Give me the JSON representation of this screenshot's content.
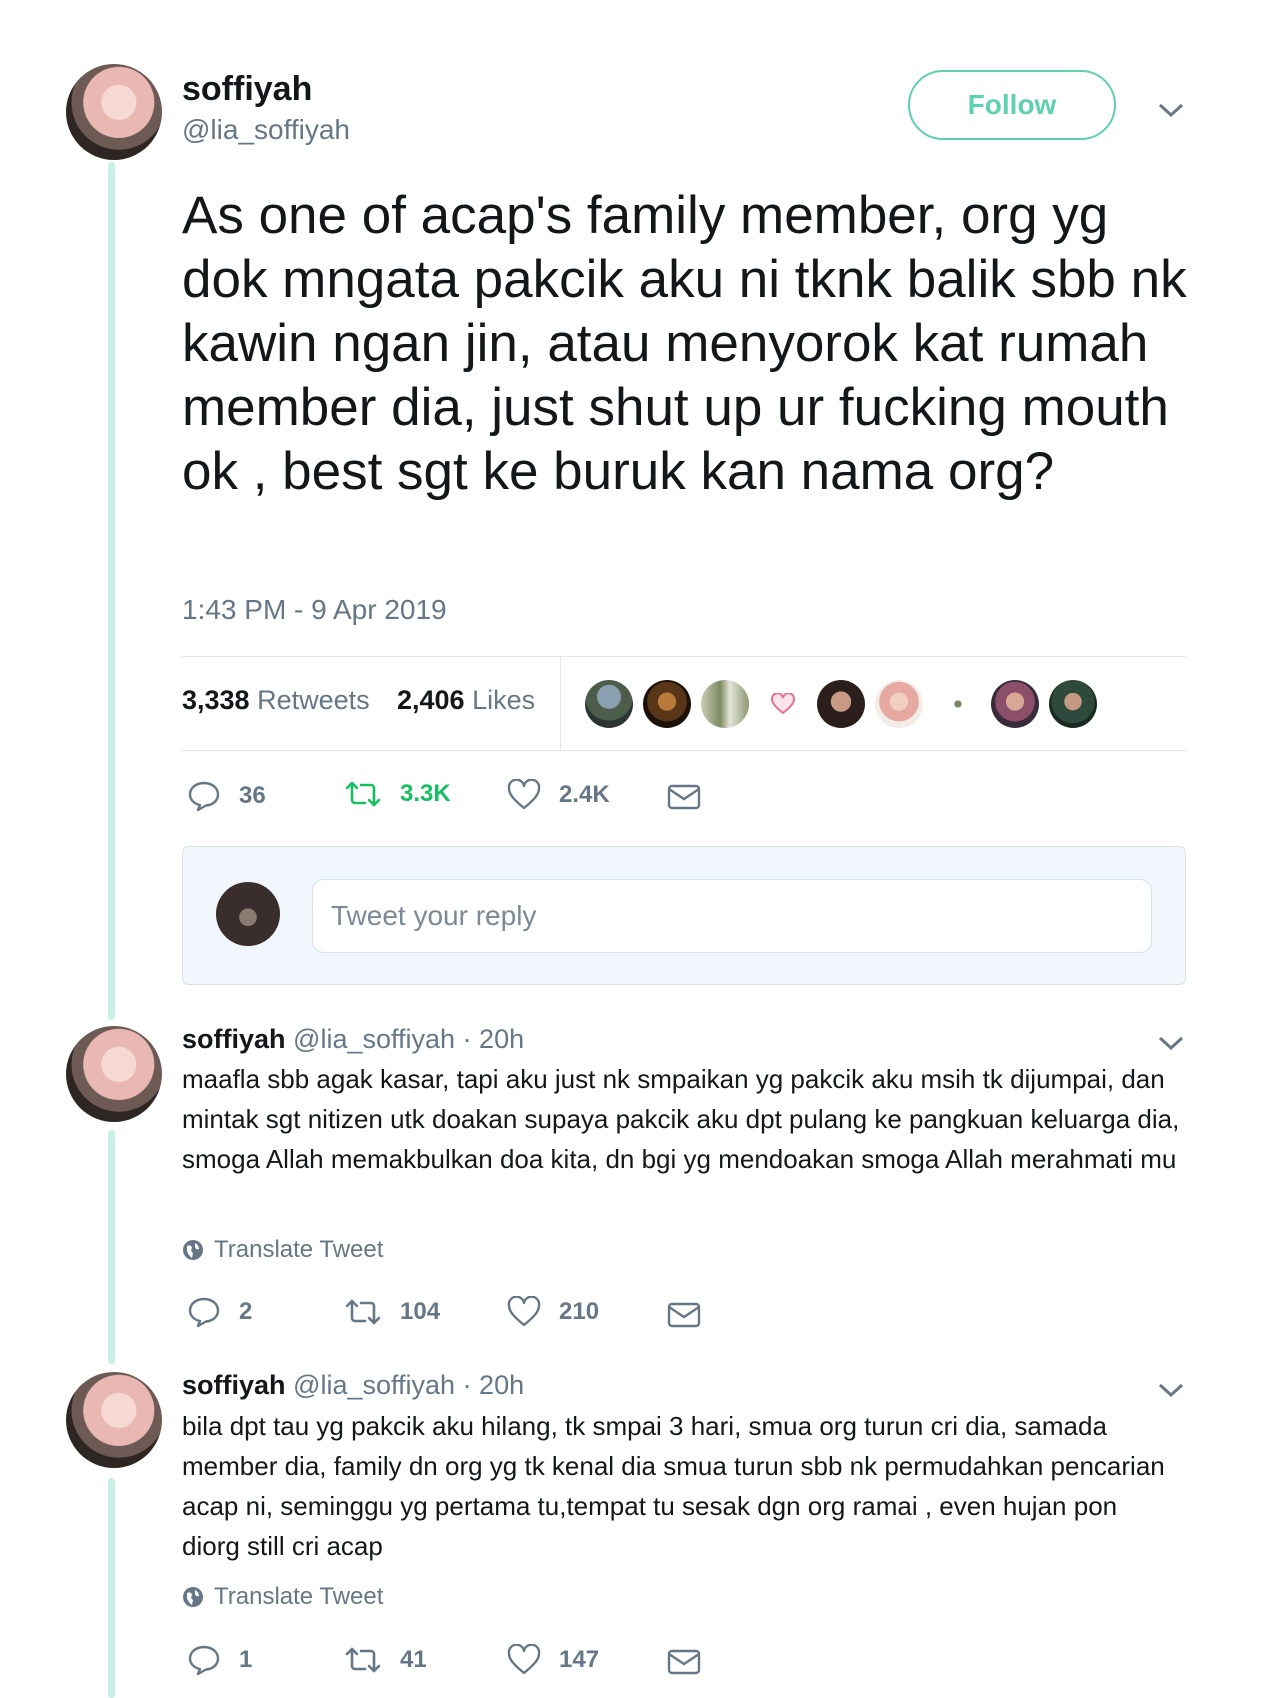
{
  "main_tweet": {
    "name": "soffiyah",
    "handle": "@lia_soffiyah",
    "follow_label": "Follow",
    "text": "As one of acap's family member, org yg dok mngata pakcik aku ni tknk balik sbb nk kawin ngan jin, atau menyorok kat rumah member dia, just shut up ur fucking mouth ok , best sgt ke buruk kan nama org?",
    "timestamp": "1:43 PM - 9 Apr 2019",
    "retweets_count": "3,338",
    "retweets_label": "Retweets",
    "likes_count": "2,406",
    "likes_label": "Likes",
    "actions": {
      "replies": "36",
      "retweets": "3.3K",
      "likes": "2.4K"
    }
  },
  "reply_box": {
    "placeholder": "Tweet your reply"
  },
  "replies": [
    {
      "name": "soffiyah",
      "handle": "@lia_soffiyah",
      "time": "· 20h",
      "text": "maafla sbb agak kasar, tapi aku just nk smpaikan yg pakcik aku msih tk dijumpai, dan mintak sgt nitizen utk doakan supaya pakcik aku dpt pulang ke pangkuan keluarga dia, smoga Allah memakbulkan doa kita, dn bgi yg mendoakan smoga Allah merahmati mu",
      "translate": "Translate Tweet",
      "actions": {
        "replies": "2",
        "retweets": "104",
        "likes": "210"
      }
    },
    {
      "name": "soffiyah",
      "handle": "@lia_soffiyah",
      "time": "· 20h",
      "text": "bila dpt tau yg pakcik aku hilang, tk smpai 3 hari, smua org turun cri dia, samada member dia, family dn org yg tk kenal dia smua turun sbb nk permudahkan pencarian acap ni, seminggu yg pertama tu,tempat tu sesak dgn org ramai , even hujan pon diorg still cri acap",
      "translate": "Translate Tweet",
      "actions": {
        "replies": "1",
        "retweets": "41",
        "likes": "147"
      }
    }
  ],
  "colors": {
    "accent": "#5fd0b0",
    "retweet_active": "#17bf63",
    "muted": "#657786",
    "thread_line": "#c9f0e6"
  }
}
